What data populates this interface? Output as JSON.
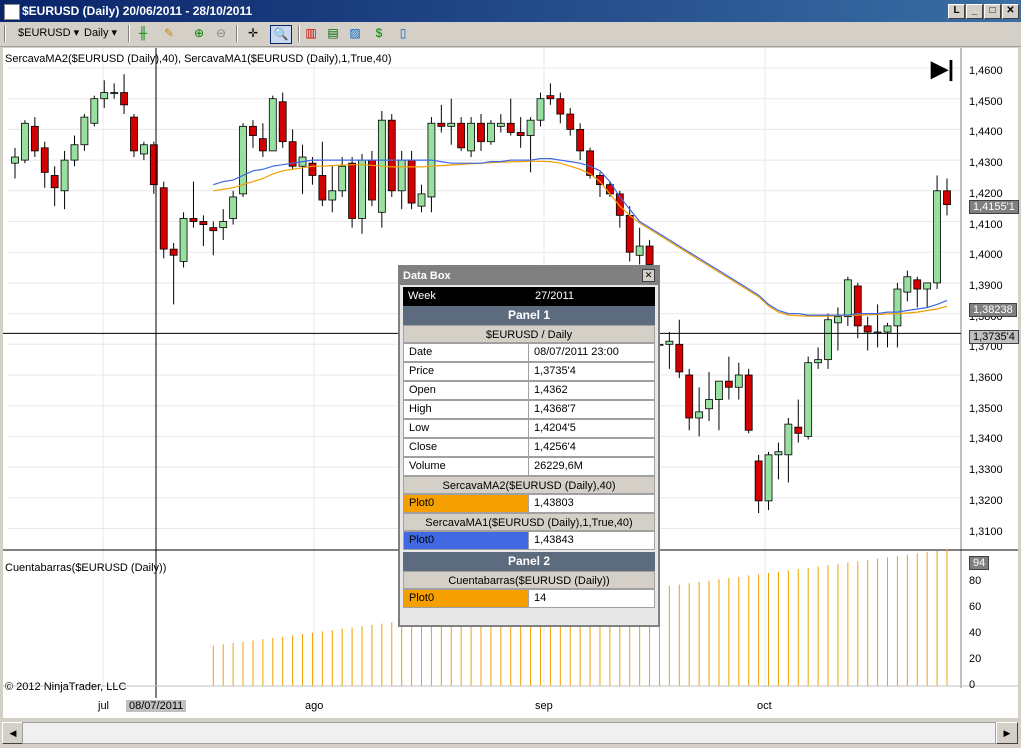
{
  "window": {
    "title": "$EURUSD (Daily)  20/06/2011 - 28/10/2011",
    "buttons": [
      "L",
      "_",
      "□",
      "✕"
    ]
  },
  "toolbar": {
    "instrument": "$EURUSD",
    "period": "Daily"
  },
  "chart": {
    "panel1_label": "SercavaMA2($EURUSD (Daily),40), SercavaMA1($EURUSD (Daily),1,True,40)",
    "panel2_label": "Cuentabarras($EURUSD (Daily))",
    "copyright": "© 2012 NinjaTrader, LLC",
    "price_ticks": [
      "1,4600",
      "1,4500",
      "1,4400",
      "1,4300",
      "1,4200",
      "1,4100",
      "1,4000",
      "1,3900",
      "1,3800",
      "1,3700",
      "1,3600",
      "1,3500",
      "1,3400",
      "1,3300",
      "1,3200",
      "1,3100"
    ],
    "indicator_ticks": [
      "80",
      "60",
      "40",
      "20",
      "0"
    ],
    "x_ticks": [
      "jul",
      "ago",
      "sep",
      "oct"
    ],
    "crosshair_date": "08/07/2011",
    "last_price_tag": "1,4155'1",
    "ma2_tag": "1,38238",
    "cursor_price_tag": "1,3735'4",
    "bar_count_tag": "94",
    "colors": {
      "up": "#98e0a0",
      "down": "#d40000",
      "ma1": "#4169e1",
      "ma2": "#f0a000",
      "barcount": "#f0a000"
    }
  },
  "chart_data": {
    "type": "candlestick",
    "x_range": [
      "20/06/2011",
      "28/10/2011"
    ],
    "ylim": [
      1.31,
      1.465
    ],
    "candles": [
      {
        "o": 1.429,
        "h": 1.434,
        "l": 1.424,
        "c": 1.431
      },
      {
        "o": 1.43,
        "h": 1.443,
        "l": 1.429,
        "c": 1.442
      },
      {
        "o": 1.441,
        "h": 1.444,
        "l": 1.431,
        "c": 1.433
      },
      {
        "o": 1.434,
        "h": 1.436,
        "l": 1.421,
        "c": 1.426
      },
      {
        "o": 1.425,
        "h": 1.428,
        "l": 1.415,
        "c": 1.421
      },
      {
        "o": 1.42,
        "h": 1.433,
        "l": 1.414,
        "c": 1.43
      },
      {
        "o": 1.43,
        "h": 1.438,
        "l": 1.428,
        "c": 1.435
      },
      {
        "o": 1.435,
        "h": 1.445,
        "l": 1.433,
        "c": 1.444
      },
      {
        "o": 1.442,
        "h": 1.451,
        "l": 1.441,
        "c": 1.45
      },
      {
        "o": 1.45,
        "h": 1.456,
        "l": 1.447,
        "c": 1.452
      },
      {
        "o": 1.452,
        "h": 1.455,
        "l": 1.45,
        "c": 1.452
      },
      {
        "o": 1.452,
        "h": 1.458,
        "l": 1.445,
        "c": 1.448
      },
      {
        "o": 1.444,
        "h": 1.445,
        "l": 1.431,
        "c": 1.433
      },
      {
        "o": 1.432,
        "h": 1.436,
        "l": 1.43,
        "c": 1.435
      },
      {
        "o": 1.435,
        "h": 1.436,
        "l": 1.419,
        "c": 1.422
      },
      {
        "o": 1.421,
        "h": 1.423,
        "l": 1.398,
        "c": 1.401
      },
      {
        "o": 1.401,
        "h": 1.403,
        "l": 1.383,
        "c": 1.399
      },
      {
        "o": 1.397,
        "h": 1.413,
        "l": 1.395,
        "c": 1.411
      },
      {
        "o": 1.411,
        "h": 1.423,
        "l": 1.408,
        "c": 1.41
      },
      {
        "o": 1.41,
        "h": 1.412,
        "l": 1.402,
        "c": 1.409
      },
      {
        "o": 1.408,
        "h": 1.41,
        "l": 1.399,
        "c": 1.407
      },
      {
        "o": 1.408,
        "h": 1.414,
        "l": 1.404,
        "c": 1.41
      },
      {
        "o": 1.411,
        "h": 1.42,
        "l": 1.409,
        "c": 1.418
      },
      {
        "o": 1.419,
        "h": 1.442,
        "l": 1.418,
        "c": 1.441
      },
      {
        "o": 1.441,
        "h": 1.443,
        "l": 1.434,
        "c": 1.438
      },
      {
        "o": 1.437,
        "h": 1.442,
        "l": 1.431,
        "c": 1.433
      },
      {
        "o": 1.433,
        "h": 1.451,
        "l": 1.433,
        "c": 1.45
      },
      {
        "o": 1.449,
        "h": 1.452,
        "l": 1.434,
        "c": 1.436
      },
      {
        "o": 1.436,
        "h": 1.44,
        "l": 1.427,
        "c": 1.428
      },
      {
        "o": 1.428,
        "h": 1.435,
        "l": 1.419,
        "c": 1.431
      },
      {
        "o": 1.429,
        "h": 1.431,
        "l": 1.422,
        "c": 1.425
      },
      {
        "o": 1.425,
        "h": 1.436,
        "l": 1.415,
        "c": 1.417
      },
      {
        "o": 1.417,
        "h": 1.428,
        "l": 1.413,
        "c": 1.42
      },
      {
        "o": 1.42,
        "h": 1.431,
        "l": 1.418,
        "c": 1.428
      },
      {
        "o": 1.429,
        "h": 1.431,
        "l": 1.408,
        "c": 1.411
      },
      {
        "o": 1.411,
        "h": 1.432,
        "l": 1.406,
        "c": 1.43
      },
      {
        "o": 1.43,
        "h": 1.433,
        "l": 1.415,
        "c": 1.417
      },
      {
        "o": 1.413,
        "h": 1.446,
        "l": 1.408,
        "c": 1.443
      },
      {
        "o": 1.443,
        "h": 1.445,
        "l": 1.418,
        "c": 1.42
      },
      {
        "o": 1.42,
        "h": 1.433,
        "l": 1.414,
        "c": 1.43
      },
      {
        "o": 1.43,
        "h": 1.433,
        "l": 1.414,
        "c": 1.416
      },
      {
        "o": 1.415,
        "h": 1.422,
        "l": 1.413,
        "c": 1.419
      },
      {
        "o": 1.418,
        "h": 1.444,
        "l": 1.413,
        "c": 1.442
      },
      {
        "o": 1.442,
        "h": 1.448,
        "l": 1.439,
        "c": 1.441
      },
      {
        "o": 1.441,
        "h": 1.45,
        "l": 1.435,
        "c": 1.442
      },
      {
        "o": 1.442,
        "h": 1.444,
        "l": 1.433,
        "c": 1.434
      },
      {
        "o": 1.433,
        "h": 1.444,
        "l": 1.431,
        "c": 1.442
      },
      {
        "o": 1.442,
        "h": 1.445,
        "l": 1.433,
        "c": 1.436
      },
      {
        "o": 1.436,
        "h": 1.443,
        "l": 1.435,
        "c": 1.442
      },
      {
        "o": 1.441,
        "h": 1.445,
        "l": 1.439,
        "c": 1.442
      },
      {
        "o": 1.442,
        "h": 1.45,
        "l": 1.438,
        "c": 1.439
      },
      {
        "o": 1.439,
        "h": 1.444,
        "l": 1.434,
        "c": 1.438
      },
      {
        "o": 1.438,
        "h": 1.444,
        "l": 1.426,
        "c": 1.443
      },
      {
        "o": 1.443,
        "h": 1.452,
        "l": 1.441,
        "c": 1.45
      },
      {
        "o": 1.451,
        "h": 1.455,
        "l": 1.448,
        "c": 1.45
      },
      {
        "o": 1.45,
        "h": 1.452,
        "l": 1.442,
        "c": 1.445
      },
      {
        "o": 1.445,
        "h": 1.447,
        "l": 1.438,
        "c": 1.44
      },
      {
        "o": 1.44,
        "h": 1.442,
        "l": 1.43,
        "c": 1.433
      },
      {
        "o": 1.433,
        "h": 1.434,
        "l": 1.424,
        "c": 1.425
      },
      {
        "o": 1.425,
        "h": 1.426,
        "l": 1.418,
        "c": 1.422
      },
      {
        "o": 1.422,
        "h": 1.423,
        "l": 1.418,
        "c": 1.419
      },
      {
        "o": 1.419,
        "h": 1.42,
        "l": 1.408,
        "c": 1.412
      },
      {
        "o": 1.412,
        "h": 1.415,
        "l": 1.397,
        "c": 1.4
      },
      {
        "o": 1.399,
        "h": 1.408,
        "l": 1.396,
        "c": 1.402
      },
      {
        "o": 1.402,
        "h": 1.404,
        "l": 1.394,
        "c": 1.396
      },
      {
        "o": 1.37,
        "h": 1.375,
        "l": 1.365,
        "c": 1.37
      },
      {
        "o": 1.37,
        "h": 1.374,
        "l": 1.362,
        "c": 1.371
      },
      {
        "o": 1.37,
        "h": 1.378,
        "l": 1.359,
        "c": 1.361
      },
      {
        "o": 1.36,
        "h": 1.362,
        "l": 1.342,
        "c": 1.346
      },
      {
        "o": 1.346,
        "h": 1.356,
        "l": 1.34,
        "c": 1.348
      },
      {
        "o": 1.349,
        "h": 1.361,
        "l": 1.345,
        "c": 1.352
      },
      {
        "o": 1.352,
        "h": 1.357,
        "l": 1.342,
        "c": 1.358
      },
      {
        "o": 1.358,
        "h": 1.366,
        "l": 1.352,
        "c": 1.356
      },
      {
        "o": 1.356,
        "h": 1.364,
        "l": 1.352,
        "c": 1.36
      },
      {
        "o": 1.36,
        "h": 1.362,
        "l": 1.341,
        "c": 1.342
      },
      {
        "o": 1.332,
        "h": 1.334,
        "l": 1.315,
        "c": 1.319
      },
      {
        "o": 1.319,
        "h": 1.335,
        "l": 1.316,
        "c": 1.334
      },
      {
        "o": 1.334,
        "h": 1.338,
        "l": 1.326,
        "c": 1.335
      },
      {
        "o": 1.334,
        "h": 1.346,
        "l": 1.325,
        "c": 1.344
      },
      {
        "o": 1.343,
        "h": 1.352,
        "l": 1.338,
        "c": 1.341
      },
      {
        "o": 1.34,
        "h": 1.366,
        "l": 1.339,
        "c": 1.364
      },
      {
        "o": 1.364,
        "h": 1.369,
        "l": 1.362,
        "c": 1.365
      },
      {
        "o": 1.365,
        "h": 1.38,
        "l": 1.362,
        "c": 1.378
      },
      {
        "o": 1.377,
        "h": 1.382,
        "l": 1.368,
        "c": 1.379
      },
      {
        "o": 1.379,
        "h": 1.392,
        "l": 1.376,
        "c": 1.391
      },
      {
        "o": 1.389,
        "h": 1.39,
        "l": 1.372,
        "c": 1.376
      },
      {
        "o": 1.376,
        "h": 1.379,
        "l": 1.368,
        "c": 1.374
      },
      {
        "o": 1.374,
        "h": 1.383,
        "l": 1.369,
        "c": 1.374
      },
      {
        "o": 1.374,
        "h": 1.377,
        "l": 1.369,
        "c": 1.376
      },
      {
        "o": 1.376,
        "h": 1.39,
        "l": 1.369,
        "c": 1.388
      },
      {
        "o": 1.387,
        "h": 1.394,
        "l": 1.384,
        "c": 1.392
      },
      {
        "o": 1.391,
        "h": 1.392,
        "l": 1.382,
        "c": 1.388
      },
      {
        "o": 1.388,
        "h": 1.39,
        "l": 1.382,
        "c": 1.39
      },
      {
        "o": 1.39,
        "h": 1.425,
        "l": 1.388,
        "c": 1.42
      },
      {
        "o": 1.42,
        "h": 1.424,
        "l": 1.412,
        "c": 1.4155
      }
    ],
    "ma1": [
      null,
      null,
      null,
      null,
      null,
      null,
      null,
      null,
      null,
      null,
      null,
      null,
      null,
      null,
      null,
      null,
      null,
      null,
      null,
      null,
      1.422,
      1.423,
      1.4235,
      1.425,
      1.4265,
      1.427,
      1.428,
      1.4285,
      1.429,
      1.4295,
      1.43,
      1.43,
      1.43,
      1.43,
      1.43,
      1.43,
      1.43,
      1.43,
      1.43,
      1.43,
      1.43,
      1.43,
      1.43,
      1.4295,
      1.429,
      1.429,
      1.429,
      1.429,
      1.4295,
      1.4295,
      1.43,
      1.43,
      1.43,
      1.4305,
      1.4305,
      1.43,
      1.4295,
      1.429,
      1.428,
      1.4265,
      1.423,
      1.418,
      1.414,
      1.41,
      1.408,
      1.406,
      1.404,
      1.402,
      1.4,
      1.398,
      1.396,
      1.394,
      1.392,
      1.39,
      1.388,
      1.386,
      1.383,
      1.381,
      1.38,
      1.38,
      1.3795,
      1.3795,
      1.3795,
      1.3795,
      1.3795,
      1.38,
      1.38,
      1.38,
      1.3805,
      1.3805,
      1.381,
      1.3815,
      1.382,
      1.383,
      1.3843
    ],
    "ma2": [
      null,
      null,
      null,
      null,
      null,
      null,
      null,
      null,
      null,
      null,
      null,
      null,
      null,
      null,
      null,
      null,
      null,
      null,
      null,
      null,
      1.42,
      1.4205,
      1.421,
      1.422,
      1.423,
      1.424,
      1.4255,
      1.4265,
      1.427,
      1.4275,
      1.428,
      1.428,
      1.4282,
      1.4284,
      1.4285,
      1.4285,
      1.4283,
      1.428,
      1.4278,
      1.4278,
      1.4278,
      1.4278,
      1.428,
      1.4282,
      1.4284,
      1.4286,
      1.4288,
      1.429,
      1.4292,
      1.4293,
      1.4294,
      1.4295,
      1.4296,
      1.4296,
      1.4295,
      1.429,
      1.428,
      1.427,
      1.4255,
      1.423,
      1.419,
      1.415,
      1.412,
      1.4095,
      1.4075,
      1.4055,
      1.4035,
      1.4015,
      1.3995,
      1.3975,
      1.3955,
      1.3935,
      1.3915,
      1.3895,
      1.3875,
      1.3855,
      1.3825,
      1.3805,
      1.3795,
      1.3793,
      1.3792,
      1.3792,
      1.3792,
      1.3793,
      1.3794,
      1.3795,
      1.3796,
      1.3797,
      1.3799,
      1.38,
      1.3802,
      1.3805,
      1.381,
      1.3815,
      1.3824
    ],
    "barcount_first": 31,
    "barcount_last": 94
  },
  "databox": {
    "title": "Data Box",
    "week_label": "Week",
    "week_value": "27/2011",
    "panel1": "Panel 1",
    "series": "$EURUSD / Daily",
    "rows": [
      {
        "k": "Date",
        "v": "08/07/2011 23:00"
      },
      {
        "k": "Price",
        "v": "1,3735'4"
      },
      {
        "k": "Open",
        "v": "1,4362"
      },
      {
        "k": "High",
        "v": "1,4368'7"
      },
      {
        "k": "Low",
        "v": "1,4204'5"
      },
      {
        "k": "Close",
        "v": "1,4256'4"
      },
      {
        "k": "Volume",
        "v": "26229,6M"
      }
    ],
    "ma2_header": "SercavaMA2($EURUSD (Daily),40)",
    "ma2_plot": "Plot0",
    "ma2_value": "1,43803",
    "ma1_header": "SercavaMA1($EURUSD (Daily),1,True,40)",
    "ma1_plot": "Plot0",
    "ma1_value": "1,43843",
    "panel2": "Panel 2",
    "cb_header": "Cuentabarras($EURUSD (Daily))",
    "cb_plot": "Plot0",
    "cb_value": "14"
  }
}
